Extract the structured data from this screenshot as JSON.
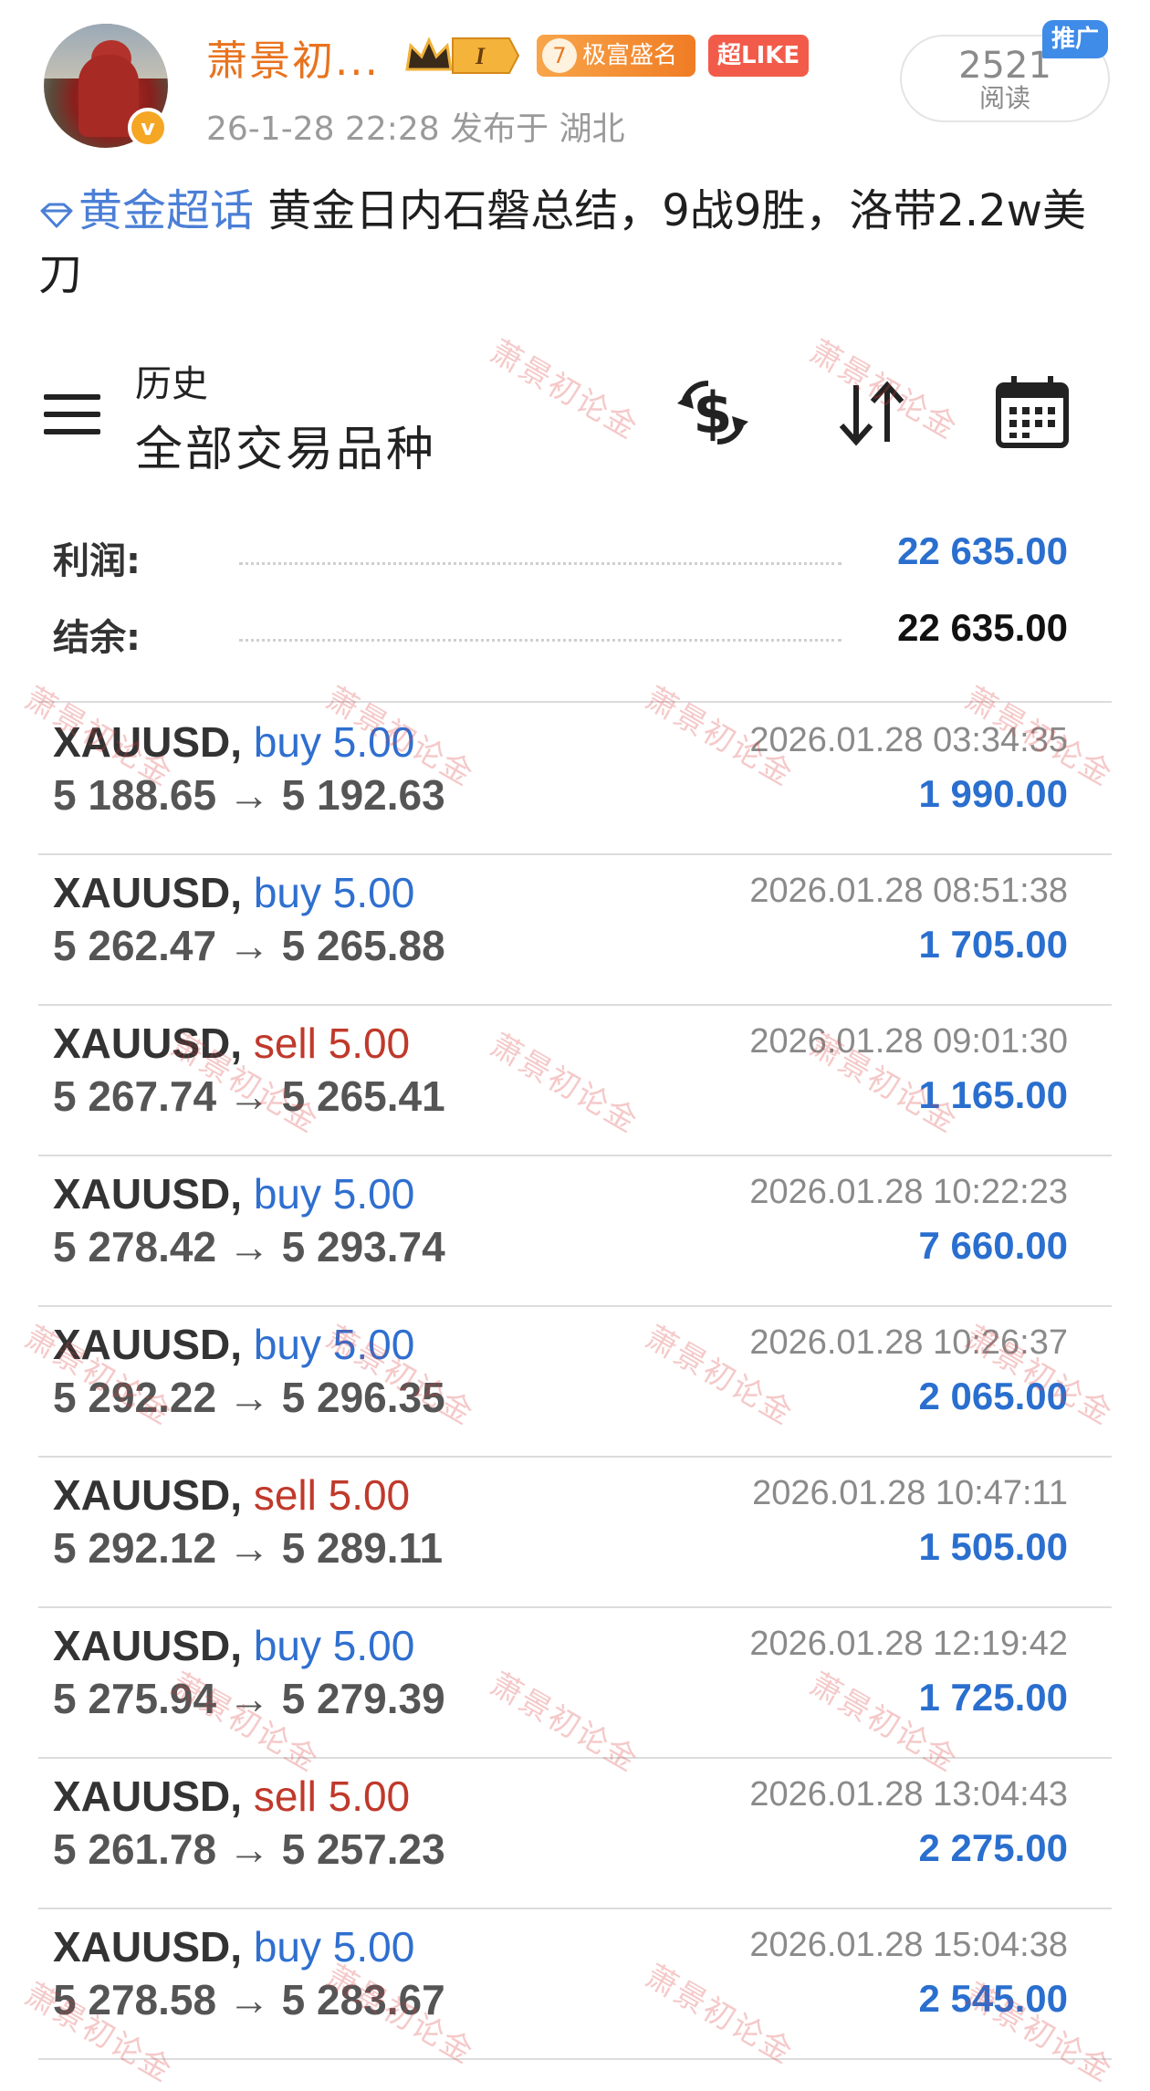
{
  "post": {
    "username": "萧景初...",
    "level_badge": "7",
    "level_text": "极富盛名",
    "like_badge": "超LIKE",
    "crown_badge": "I",
    "verify_mark": "v",
    "meta": "26-1-28 22:28   发布于 湖北",
    "read_count": "2521",
    "read_label": "阅读",
    "promo_tag": "推广",
    "topic": "黄金超话",
    "text": "  黄金日内石磐总结，9战9胜，洛带2.2w美刀"
  },
  "app": {
    "section_sub": "历史",
    "section_title": "全部交易品种",
    "icons": [
      "menu-icon",
      "currency-exchange-icon",
      "sort-icon",
      "calendar-icon"
    ]
  },
  "summary": {
    "profit_label": "利润:",
    "profit_value": "22 635.00",
    "balance_label": "结余:",
    "balance_value": "22 635.00"
  },
  "trades": [
    {
      "symbol": "XAUUSD,",
      "direction": "buy 5.00",
      "side": "buy",
      "prices": "5 188.65 → 5 192.63",
      "time": "2026.01.28 03:34:35",
      "profit": "1 990.00"
    },
    {
      "symbol": "XAUUSD,",
      "direction": "buy 5.00",
      "side": "buy",
      "prices": "5 262.47 → 5 265.88",
      "time": "2026.01.28 08:51:38",
      "profit": "1 705.00"
    },
    {
      "symbol": "XAUUSD,",
      "direction": "sell 5.00",
      "side": "sell",
      "prices": "5 267.74 → 5 265.41",
      "time": "2026.01.28 09:01:30",
      "profit": "1 165.00"
    },
    {
      "symbol": "XAUUSD,",
      "direction": "buy 5.00",
      "side": "buy",
      "prices": "5 278.42 → 5 293.74",
      "time": "2026.01.28 10:22:23",
      "profit": "7 660.00"
    },
    {
      "symbol": "XAUUSD,",
      "direction": "buy 5.00",
      "side": "buy",
      "prices": "5 292.22 → 5 296.35",
      "time": "2026.01.28 10:26:37",
      "profit": "2 065.00"
    },
    {
      "symbol": "XAUUSD,",
      "direction": "sell 5.00",
      "side": "sell",
      "prices": "5 292.12 → 5 289.11",
      "time": "2026.01.28 10:47:11",
      "profit": "1 505.00"
    },
    {
      "symbol": "XAUUSD,",
      "direction": "buy 5.00",
      "side": "buy",
      "prices": "5 275.94 → 5 279.39",
      "time": "2026.01.28 12:19:42",
      "profit": "1 725.00"
    },
    {
      "symbol": "XAUUSD,",
      "direction": "sell 5.00",
      "side": "sell",
      "prices": "5 261.78 → 5 257.23",
      "time": "2026.01.28 13:04:43",
      "profit": "2 275.00"
    },
    {
      "symbol": "XAUUSD,",
      "direction": "buy 5.00",
      "side": "buy",
      "prices": "5 278.58 → 5 283.67",
      "time": "2026.01.28 15:04:38",
      "profit": "2 545.00"
    }
  ],
  "watermark_text": "萧景初论金",
  "colors": {
    "buy": "#2f6fd0",
    "sell": "#c0392b",
    "profit": "#2a6fcf",
    "username": "#e8731f",
    "topic": "#4b7fd6"
  }
}
